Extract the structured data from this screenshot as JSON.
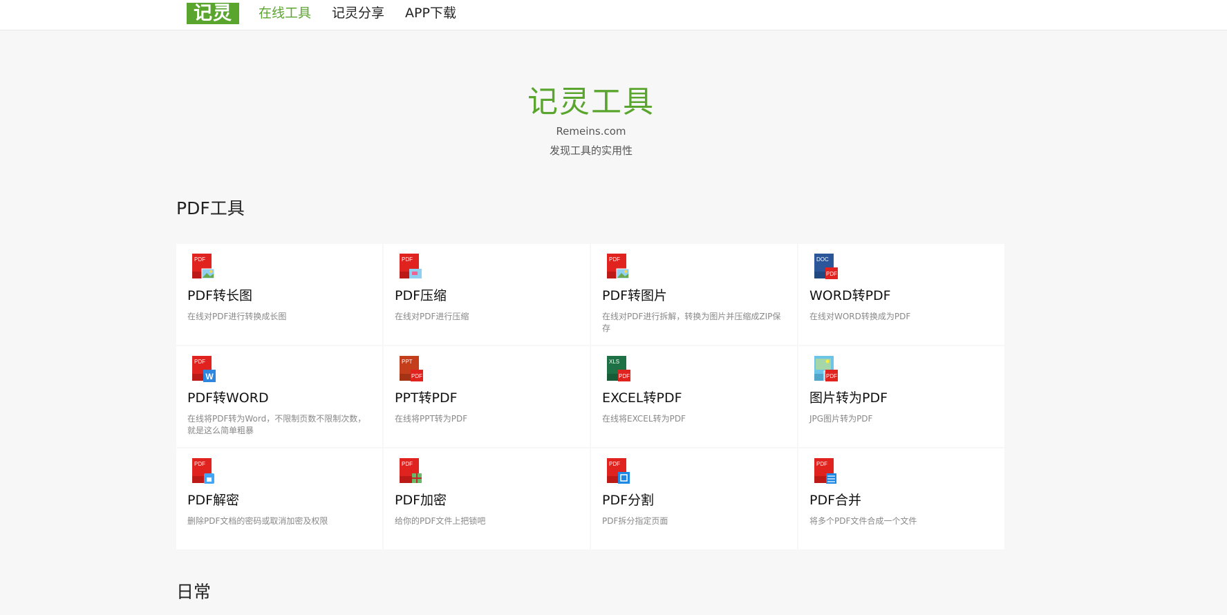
{
  "header": {
    "logo_text": "记灵",
    "nav": [
      {
        "label": "在线工具",
        "active": true
      },
      {
        "label": "记灵分享",
        "active": false
      },
      {
        "label": "APP下载",
        "active": false
      }
    ]
  },
  "hero": {
    "title": "记灵工具",
    "domain": "Remeins.com",
    "slogan": "发现工具的实用性"
  },
  "sections": [
    {
      "title": "PDF工具"
    },
    {
      "title": "日常"
    }
  ],
  "tools": [
    {
      "name": "PDF转长图",
      "desc": "在线对PDF进行转换成长图",
      "icon": "pdf-to-long-image-icon",
      "badge": "PDF"
    },
    {
      "name": "PDF压缩",
      "desc": "在线对PDF进行压缩",
      "icon": "pdf-compress-icon",
      "badge": "PDF"
    },
    {
      "name": "PDF转图片",
      "desc": "在线对PDF进行拆解，转换为图片并压缩成ZIP保存",
      "icon": "pdf-to-image-icon",
      "badge": "PDF"
    },
    {
      "name": "WORD转PDF",
      "desc": "在线对WORD转换成为PDF",
      "icon": "word-to-pdf-icon",
      "badge": "DOC"
    },
    {
      "name": "PDF转WORD",
      "desc": "在线将PDF转为Word，不限制页数不限制次数，就是这么简单粗暴",
      "icon": "pdf-to-word-icon",
      "badge": "PDF"
    },
    {
      "name": "PPT转PDF",
      "desc": "在线将PPT转为PDF",
      "icon": "ppt-to-pdf-icon",
      "badge": "PPT"
    },
    {
      "name": "EXCEL转PDF",
      "desc": "在线将EXCEL转为PDF",
      "icon": "excel-to-pdf-icon",
      "badge": "XLS"
    },
    {
      "name": "图片转为PDF",
      "desc": "JPG图片转为PDF",
      "icon": "image-to-pdf-icon",
      "badge": ""
    },
    {
      "name": "PDF解密",
      "desc": "删除PDF文档的密码或取消加密及权限",
      "icon": "pdf-decrypt-icon",
      "badge": "PDF"
    },
    {
      "name": "PDF加密",
      "desc": "给你的PDF文件上把锁吧",
      "icon": "pdf-encrypt-icon",
      "badge": "PDF"
    },
    {
      "name": "PDF分割",
      "desc": "PDF拆分指定页面",
      "icon": "pdf-split-icon",
      "badge": "PDF"
    },
    {
      "name": "PDF合并",
      "desc": "将多个PDF文件合成一个文件",
      "icon": "pdf-merge-icon",
      "badge": "PDF"
    }
  ],
  "colors": {
    "accent": "#5aa52e",
    "pdf_red": "#e0231f",
    "word_blue": "#2b579a",
    "ppt_orange": "#c43e1c",
    "excel_green": "#1e7145"
  }
}
